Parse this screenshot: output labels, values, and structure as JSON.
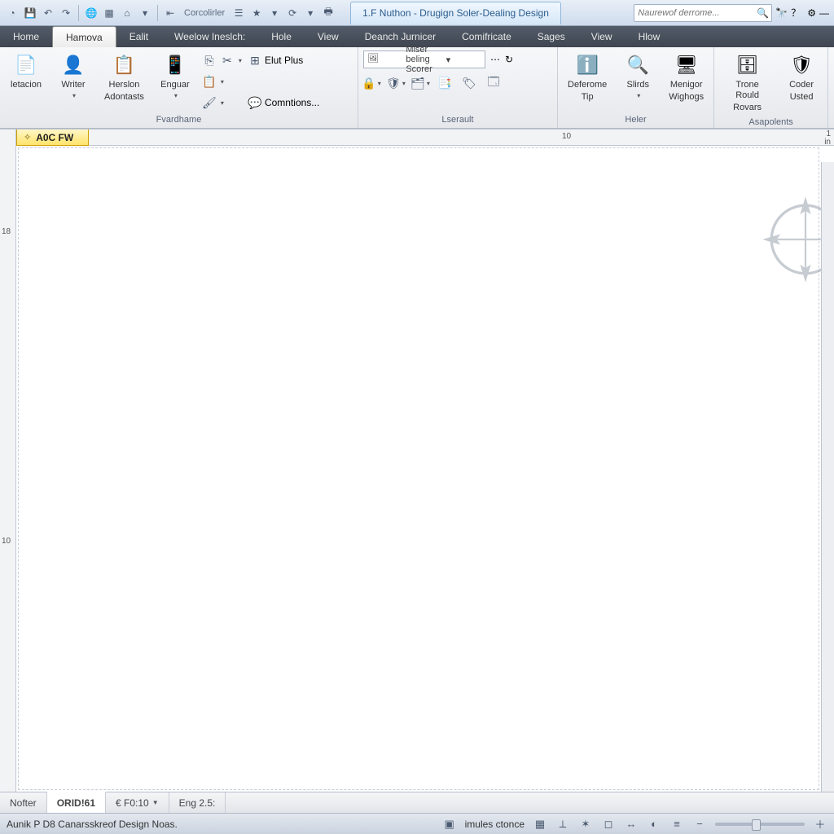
{
  "titlebar": {
    "doc_title": "1.F Nuthon - Drugign Soler-Dealing Design",
    "qat_label": "Corcolirler",
    "search_placeholder": "Naurewof derrome..."
  },
  "menubar": {
    "tabs": [
      {
        "label": "Home"
      },
      {
        "label": "Hamova",
        "active": true
      },
      {
        "label": "Ealit"
      },
      {
        "label": "Weelow Ineslch:"
      },
      {
        "label": "Hole"
      },
      {
        "label": "View"
      },
      {
        "label": "Deanch Jurnicer"
      },
      {
        "label": "Comifricate"
      },
      {
        "label": "Sages"
      },
      {
        "label": "View"
      },
      {
        "label": "Hlow"
      }
    ]
  },
  "ribbon": {
    "groups": [
      {
        "label": "Fvardhame",
        "items": [
          {
            "label1": "letacion",
            "label2": ""
          },
          {
            "label1": "Writer",
            "label2": ""
          },
          {
            "label1": "Herslon",
            "label2": "Adontasts"
          },
          {
            "label1": "Enguar",
            "label2": ""
          }
        ],
        "side": {
          "elut": "Elut Plus",
          "comments": "Comntions..."
        }
      },
      {
        "label": "Lserault",
        "combo": "Miser beling Scorer"
      },
      {
        "label": "Heler",
        "items": [
          {
            "label1": "Deferome",
            "label2": "Tip"
          },
          {
            "label1": "Slirds",
            "label2": ""
          },
          {
            "label1": "Menigor",
            "label2": "Wighogs"
          }
        ]
      },
      {
        "label": "Asapolents",
        "items": [
          {
            "label1": "Trone Rould",
            "label2": "Rovars"
          },
          {
            "label1": "Coder",
            "label2": "Usted"
          }
        ]
      }
    ]
  },
  "sheet_tab": "A0C FW",
  "ruler": {
    "h_mark": "10",
    "h_mark2": "1",
    "h_unit": "in",
    "v_mark1": "18",
    "v_mark2": "10"
  },
  "bottom_tabs": [
    {
      "label": "Nofter"
    },
    {
      "label": "ORID!61",
      "active": true
    },
    {
      "label": "€ F0:10"
    },
    {
      "label": "Eng 2.5:"
    }
  ],
  "status": {
    "left": "Aunik P D8 Canarsskreof Design Noas.",
    "center": "imules ctonce"
  }
}
